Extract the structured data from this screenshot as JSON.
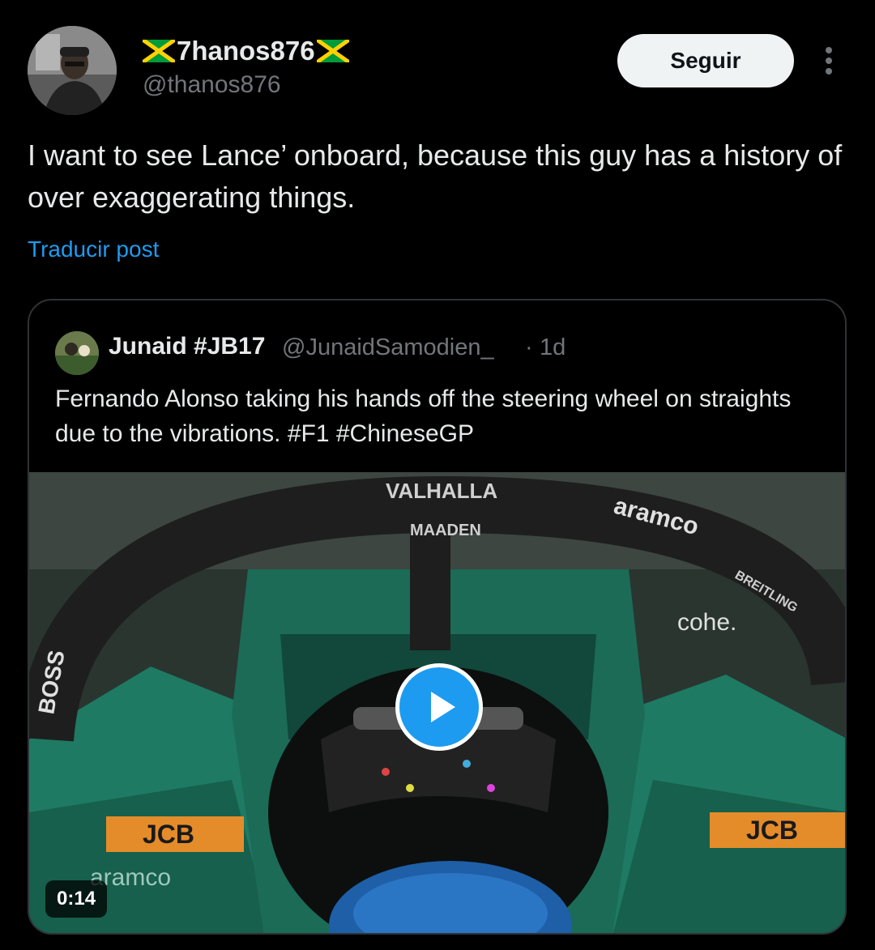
{
  "author": {
    "display_name": "7hanos876",
    "handle": "@thanos876",
    "flag_icon": "jamaica-flag-icon"
  },
  "follow_label": "Seguir",
  "tweet": {
    "text": "I want to see Lance’ onboard, because this guy has a history of over exaggerating things.",
    "translate_label": "Traducir post"
  },
  "quote": {
    "name": "Junaid #JB17",
    "handle": "@JunaidSamodien_",
    "separator": "·",
    "time": "1d",
    "text": "Fernando Alonso taking his hands off the steering wheel on straights due to the vibrations. #F1 #ChineseGP",
    "video": {
      "duration": "0:14",
      "halo_labels": {
        "valhalla": "VALHALLA",
        "maaden": "MAADEN",
        "aramco": "aramco",
        "boss": "BOSS",
        "cohere": "cohe.",
        "breitling": "BREITLING",
        "jcb": "JCB",
        "aramco_bottom": "aramco"
      }
    }
  },
  "colors": {
    "background": "#000000",
    "accent": "#1d9bf0",
    "text_primary": "#e7e9ea",
    "text_secondary": "#71767b",
    "car_green": "#1f6b5a"
  }
}
